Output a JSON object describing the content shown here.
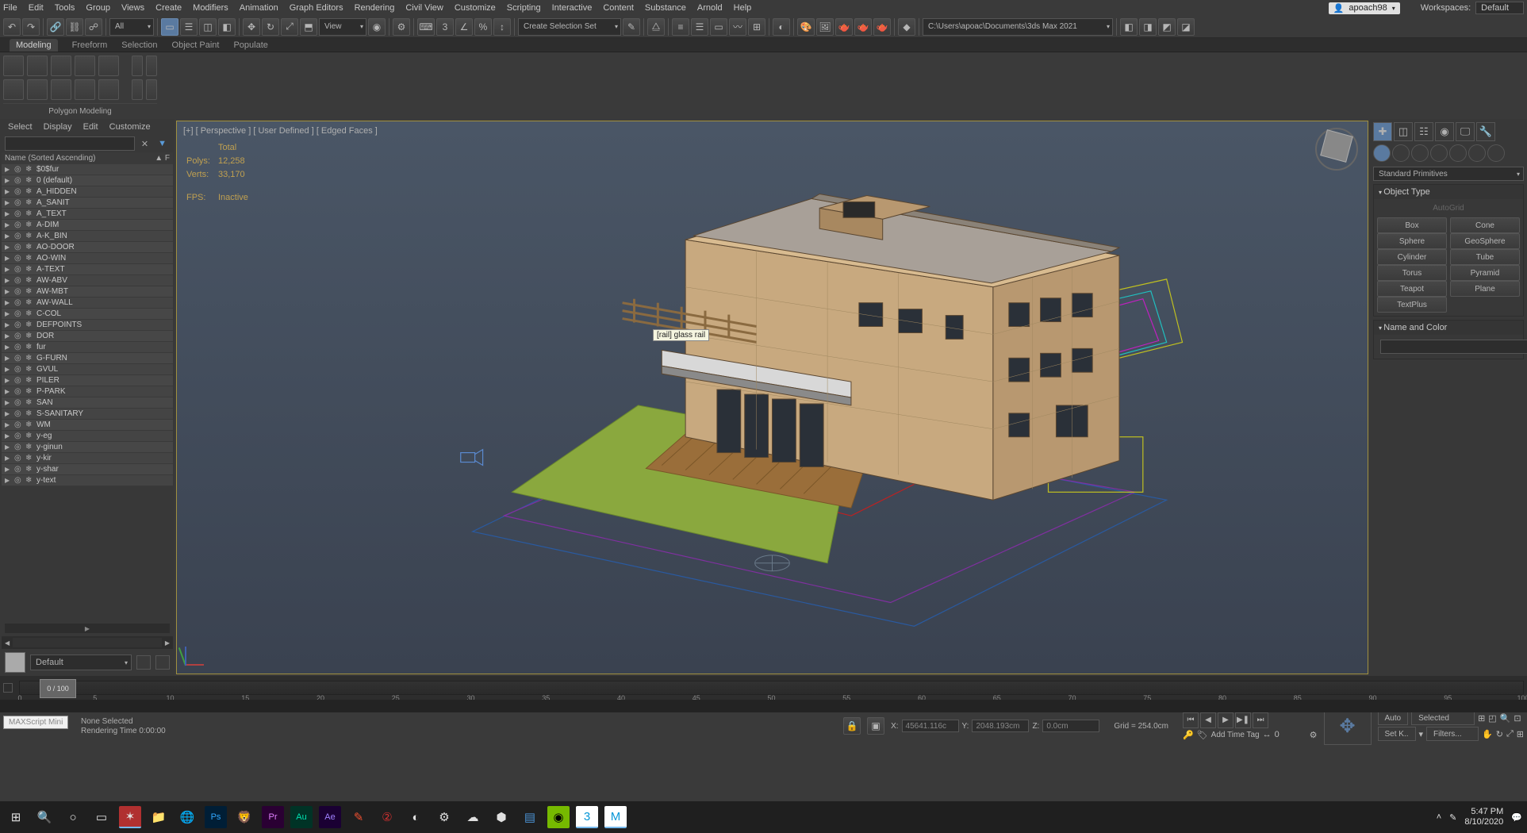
{
  "menubar": [
    "File",
    "Edit",
    "Tools",
    "Group",
    "Views",
    "Create",
    "Modifiers",
    "Animation",
    "Graph Editors",
    "Rendering",
    "Civil View",
    "Customize",
    "Scripting",
    "Interactive",
    "Content",
    "Substance",
    "Arnold",
    "Help"
  ],
  "user": "apoach98",
  "workspaces": {
    "label": "Workspaces:",
    "value": "Default"
  },
  "toolbar": {
    "all": "All",
    "view": "View",
    "selection_set": "Create Selection Set",
    "project_path": "C:\\Users\\apoac\\Documents\\3ds Max 2021"
  },
  "ribbon": {
    "tabs": [
      "Modeling",
      "Freeform",
      "Selection",
      "Object Paint",
      "Populate"
    ],
    "active": 0,
    "group_label": "Polygon Modeling"
  },
  "scene_explorer": {
    "menus": [
      "Select",
      "Display",
      "Edit",
      "Customize"
    ],
    "header": "Name (Sorted Ascending)",
    "header_suffix": "▲  F",
    "items": [
      "$0$fur",
      "0 (default)",
      "A_HIDDEN",
      "A_SANIT",
      "A_TEXT",
      "A-DIM",
      "A-K_BIN",
      "AO-DOOR",
      "AO-WIN",
      "A-TEXT",
      "AW-ABV",
      "AW-MBT",
      "AW-WALL",
      "C-COL",
      "DEFPOINTS",
      "DOR",
      "fur",
      "G-FURN",
      "GVUL",
      "PILER",
      "P-PARK",
      "SAN",
      "S-SANITARY",
      "WM",
      "y-eg",
      "y-ginun",
      "y-kir",
      "y-shar",
      "y-text"
    ],
    "material": "Default"
  },
  "viewport": {
    "label": "[+] [ Perspective ] [ User Defined ] [ Edged Faces ]",
    "stats": {
      "total": "Total",
      "polys_label": "Polys:",
      "polys": "12,258",
      "verts_label": "Verts:",
      "verts": "33,170",
      "fps_label": "FPS:",
      "fps": "Inactive"
    },
    "tooltip": "[rail] glass rail"
  },
  "command_panel": {
    "category": "Standard Primitives",
    "object_type": "Object Type",
    "autogrid": "AutoGrid",
    "buttons": [
      [
        "Box",
        "Cone"
      ],
      [
        "Sphere",
        "GeoSphere"
      ],
      [
        "Cylinder",
        "Tube"
      ],
      [
        "Torus",
        "Pyramid"
      ],
      [
        "Teapot",
        "Plane"
      ],
      [
        "TextPlus",
        ""
      ]
    ],
    "name_and_color": "Name and Color"
  },
  "timeline": {
    "frame": "0 / 100",
    "ticks": [
      "0",
      "5",
      "10",
      "15",
      "20",
      "25",
      "30",
      "35",
      "40",
      "45",
      "50",
      "55",
      "60",
      "65",
      "70",
      "75",
      "80",
      "85",
      "90",
      "95",
      "100"
    ]
  },
  "status": {
    "none_selected": "None Selected",
    "render_time": "Rendering Time  0:00:00",
    "x_label": "X:",
    "x": "45641.116c",
    "y_label": "Y:",
    "y": "2048.193cm",
    "z_label": "Z:",
    "z": "0.0cm",
    "grid": "Grid = 254.0cm",
    "add_time_tag": "Add Time Tag",
    "auto": "Auto",
    "setk": "Set K..",
    "selected": "Selected",
    "filters": "Filters...",
    "frame_num": "0"
  },
  "maxscript": "MAXScript Mini",
  "taskbar": {
    "time": "5:47 PM",
    "date": "8/10/2020"
  }
}
